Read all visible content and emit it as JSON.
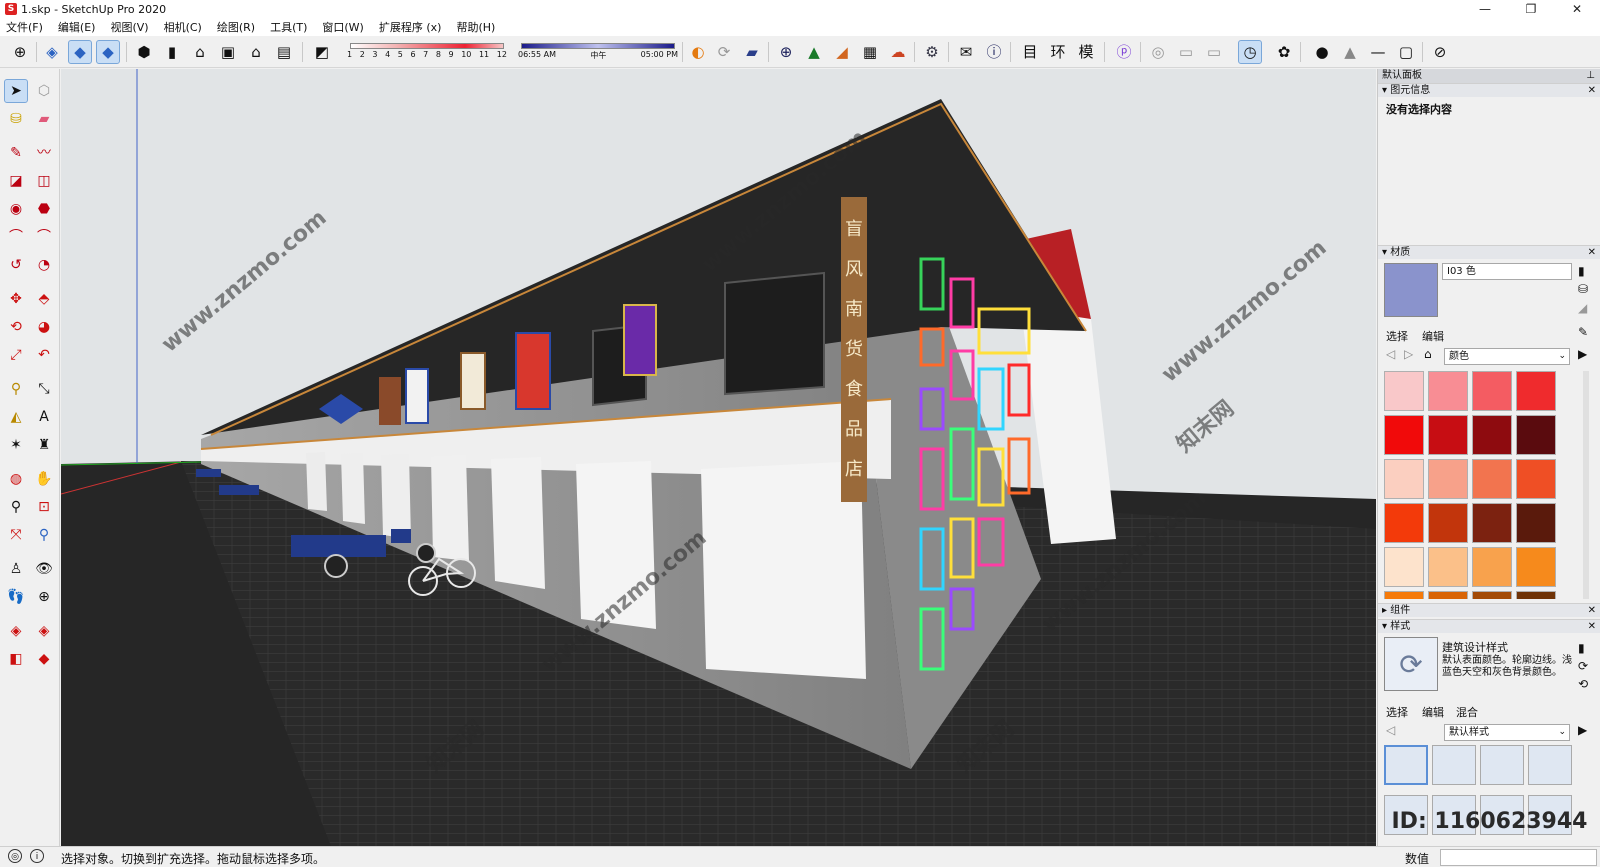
{
  "app": {
    "title": "1.skp - SketchUp Pro 2020",
    "window_buttons": [
      "—",
      "❐",
      "✕"
    ]
  },
  "menu": [
    "文件(F)",
    "编辑(E)",
    "视图(V)",
    "相机(C)",
    "绘图(R)",
    "工具(T)",
    "窗口(W)",
    "扩展程序 (x)",
    "帮助(H)"
  ],
  "shadow": {
    "months": [
      "1",
      "2",
      "3",
      "4",
      "5",
      "6",
      "7",
      "8",
      "9",
      "10",
      "11",
      "12"
    ],
    "time_start": "06:55 AM",
    "time_mid": "中午",
    "time_end": "05:00 PM"
  },
  "toolbar_text_icons": [
    "目",
    "环",
    "模"
  ],
  "tray": {
    "title": "默认面板",
    "entity_info": {
      "header": "图元信息",
      "text": "没有选择内容"
    },
    "materials": {
      "header": "材质",
      "current_name": "I03 色",
      "current_color": "#8a93cc",
      "tabs": [
        "选择",
        "编辑"
      ],
      "library": "颜色",
      "swatches": [
        "#f9c8c9",
        "#f88d94",
        "#f45c62",
        "#ef2b2d",
        "#f10a0a",
        "#c70d13",
        "#8e0b0f",
        "#5a0b0e",
        "#fbcfc0",
        "#f7a18a",
        "#f2744f",
        "#ef4f25",
        "#f33a0a",
        "#c2350c",
        "#7c2210",
        "#5a1a0c",
        "#fde3cc",
        "#fbc089",
        "#f8a24d",
        "#f68a1c",
        "#f57a0a",
        "#d96405",
        "#a34a06",
        "#6f3307"
      ]
    },
    "components": {
      "header": "组件"
    },
    "styles": {
      "header": "样式",
      "name": "建筑设计样式",
      "description": "默认表面颜色。轮廓边线。浅蓝色天空和灰色背景颜色。",
      "tabs": [
        "选择",
        "编辑",
        "混合"
      ],
      "library": "默认样式"
    }
  },
  "status": {
    "hint": "选择对象。切换到扩充选择。拖动鼠标选择多项。",
    "measure_label": "数值",
    "measure_value": ""
  },
  "viewport": {
    "colors": {
      "sky": "#e1e4e6",
      "ground": "#262626",
      "wall": "#8f8f8f",
      "roof": "#2a2a2a"
    },
    "vertical_sign": [
      "盲",
      "风",
      "南",
      "货",
      "食",
      "品",
      "店"
    ],
    "watermark": [
      "www.znzmo.com",
      "知末网"
    ],
    "id_text": "ID: 1160623944"
  }
}
